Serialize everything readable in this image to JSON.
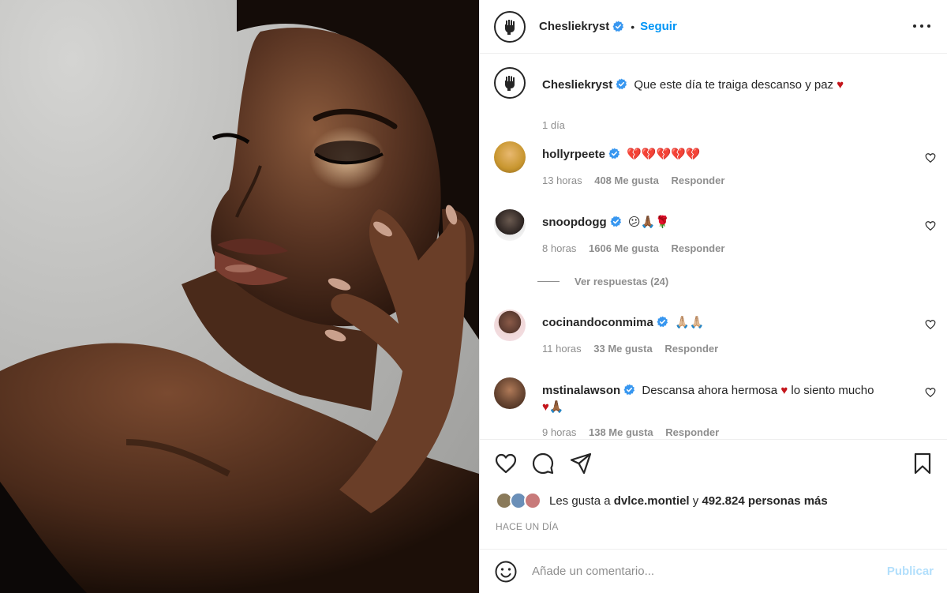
{
  "post": {
    "author": "Chesliekryst",
    "separator": "•",
    "follow_label": "Seguir"
  },
  "caption": {
    "author": "Chesliekryst",
    "text": "Que este día te traiga descanso y paz",
    "heart": "♥",
    "time": "1 día"
  },
  "comments": [
    {
      "user": "hollyrpeete",
      "text": "💔💔💔💔💔",
      "time": "13 horas",
      "likes": "408 Me gusta",
      "reply": "Responder",
      "avatar_color": "#d4a437"
    },
    {
      "user": "snoopdogg",
      "text": "😕🙏🏾🌹",
      "time": "8 horas",
      "likes": "1606 Me gusta",
      "reply": "Responder",
      "avatar_color": "#2a2a2a"
    },
    {
      "user": "cocinandoconmima",
      "text": "🙏🏼🙏🏼",
      "time": "11 horas",
      "likes": "33 Me gusta",
      "reply": "Responder",
      "avatar_color": "#b98e7c"
    },
    {
      "user": "mstinalawson",
      "text": "Descansa ahora hermosa",
      "text_heart": "♥",
      "text_after": "lo siento mucho",
      "text_line2": "🙏🏾",
      "time": "9 horas",
      "likes": "138 Me gusta",
      "reply": "Responder",
      "avatar_color": "#6e4a35"
    }
  ],
  "view_replies": "Ver respuestas (24)",
  "likes": {
    "prefix": "Les gusta a",
    "user": "dvlce.montiel",
    "middle": "y",
    "count": "492.824 personas más"
  },
  "time_ago": "HACE UN DÍA",
  "add_comment": {
    "placeholder": "Añade un comentario...",
    "publish": "Publicar"
  },
  "colors": {
    "accent": "#0095f6",
    "heart": "#c4161c",
    "muted": "#8e8e8e",
    "publish_disabled": "#b2dffc"
  },
  "icons": [
    "fist-avatar-icon",
    "verified-badge-icon",
    "more-options-icon",
    "heart-icon",
    "comment-icon",
    "share-icon",
    "bookmark-icon",
    "smile-icon"
  ]
}
